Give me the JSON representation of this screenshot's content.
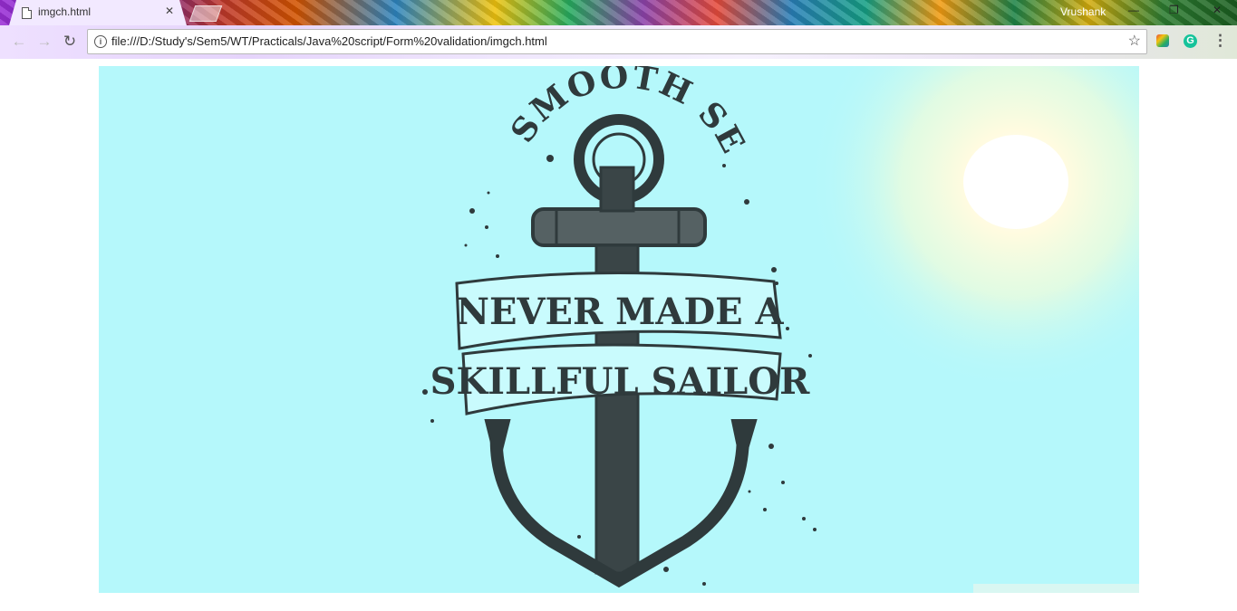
{
  "browser": {
    "tab": {
      "title": "imgch.html",
      "close_glyph": "✕",
      "icon": "document-icon"
    },
    "profile_name": "Vrushank",
    "window_controls": {
      "minimize": "—",
      "maximize": "❐",
      "close": "✕"
    },
    "toolbar": {
      "back_glyph": "←",
      "forward_glyph": "→",
      "reload_glyph": "↻",
      "url": "file:///D:/Study's/Sem5/WT/Practicals/Java%20script/Form%20validation/imgch.html",
      "info_glyph": "i",
      "bookmark_glyph": "☆",
      "extension_glyph": "G",
      "menu_glyph": "⋮"
    }
  },
  "poster": {
    "text_arc": "A SMOOTH SEA",
    "banner_line1": "NEVER MADE A",
    "banner_line2": "SKILLFUL SAILOR",
    "colors": {
      "background": "#b5f8fb",
      "ink": "#2f3a3c",
      "sun": "#fffde7"
    }
  }
}
